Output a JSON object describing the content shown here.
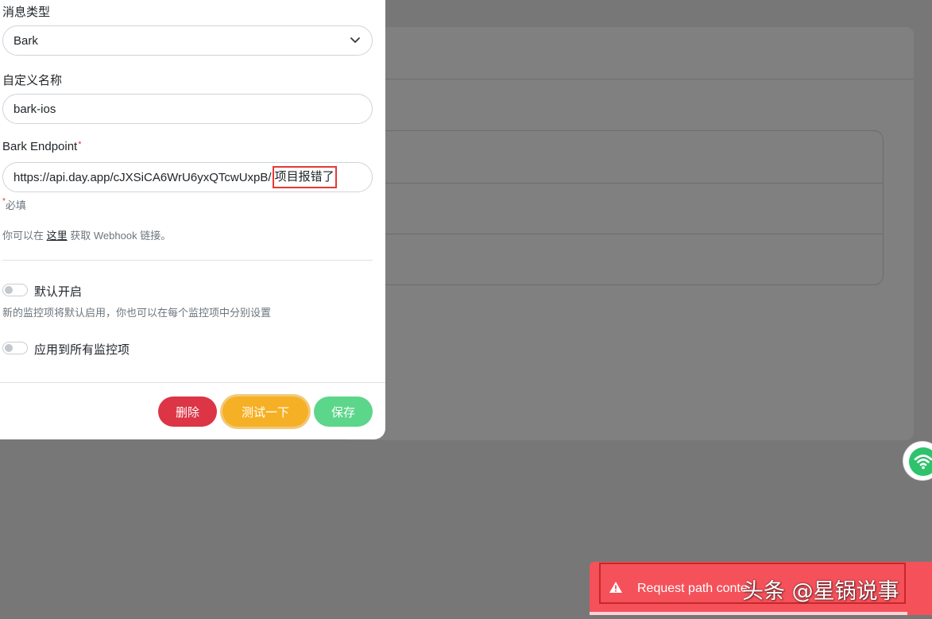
{
  "form": {
    "message_type_label": "消息类型",
    "message_type_value": "Bark",
    "custom_name_label": "自定义名称",
    "custom_name_value": "bark-ios",
    "endpoint_label": "Bark Endpoint",
    "endpoint_required_mark": "*",
    "endpoint_value_prefix": "https://api.day.app/cJXSiCA6WrU6yxQTcwUxpB/",
    "endpoint_value_highlight": "项目报错了",
    "required_mark": "*",
    "required_hint": "必填",
    "webhook_hint_before": "你可以在",
    "webhook_hint_link": "这里",
    "webhook_hint_after": "获取 Webhook 链接。",
    "default_enabled_label": "默认开启",
    "default_enabled_hint": "新的监控项将默认启用，你也可以在每个监控项中分别设置",
    "apply_all_label": "应用到所有监控项"
  },
  "buttons": {
    "delete": "删除",
    "test": "测试一下",
    "save": "保存"
  },
  "toast": {
    "message": "Request path conte",
    "watermark": "头条 @星锅说事"
  },
  "colors": {
    "danger": "#dc3545",
    "warning": "#f6b025",
    "success": "#5cd68a",
    "toast": "#f5515a",
    "wifi": "#2fc26c"
  },
  "icons": [
    "chevron-down-icon",
    "warning-icon",
    "wifi-icon"
  ]
}
